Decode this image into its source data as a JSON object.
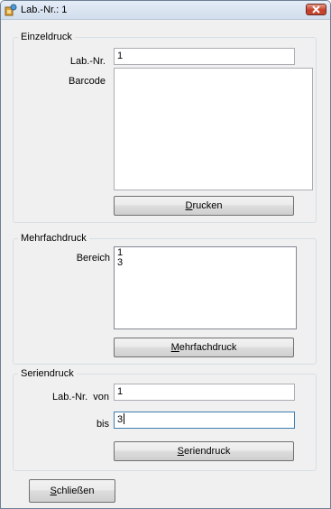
{
  "window": {
    "title": "Lab.-Nr.: 1"
  },
  "einzeldruck": {
    "group_title": "Einzeldruck",
    "labnr_label": "Lab.-Nr.",
    "labnr_value": "1",
    "barcode_label": "Barcode",
    "print_button": {
      "mnemonic": "D",
      "rest": "rucken"
    }
  },
  "mehrfachdruck": {
    "group_title": "Mehrfachdruck",
    "range_label": "Bereich",
    "range_items": [
      "1",
      "3"
    ],
    "print_button": {
      "mnemonic": "M",
      "rest": "ehrfachdruck"
    }
  },
  "seriendruck": {
    "group_title": "Seriendruck",
    "from_label": "Lab.-Nr.  von",
    "from_value": "1",
    "to_label": "bis",
    "to_value": "3",
    "print_button": {
      "mnemonic": "S",
      "rest": "eriendruck"
    }
  },
  "close_button": {
    "mnemonic": "S",
    "rest": "chließen"
  }
}
